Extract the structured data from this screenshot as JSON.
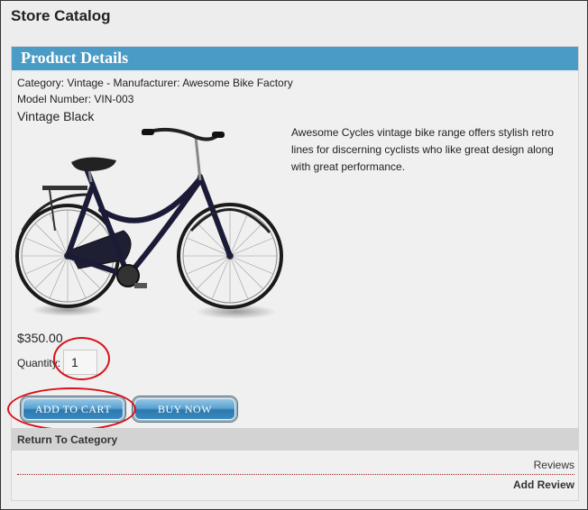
{
  "page": {
    "title": "Store Catalog"
  },
  "panel": {
    "title": "Product Details"
  },
  "product": {
    "category_line": "Category: Vintage - Manufacturer: Awesome Bike Factory",
    "model_line": "Model Number: VIN-003",
    "name": "Vintage Black",
    "description": "Awesome Cycles vintage bike range offers stylish retro lines for discerning cyclists who like great design along with great performance.",
    "price": "$350.00",
    "quantity_label": "Quantity:",
    "quantity_value": "1"
  },
  "buttons": {
    "add_to_cart": "ADD TO CART",
    "buy_now": "BUY NOW"
  },
  "footer": {
    "return_label": "Return To Category",
    "reviews_label": "Reviews",
    "add_review_label": "Add Review"
  },
  "colors": {
    "header_blue": "#4a9bc5",
    "annotation_red": "#d8111b",
    "button_blue": "#2c79ad"
  }
}
